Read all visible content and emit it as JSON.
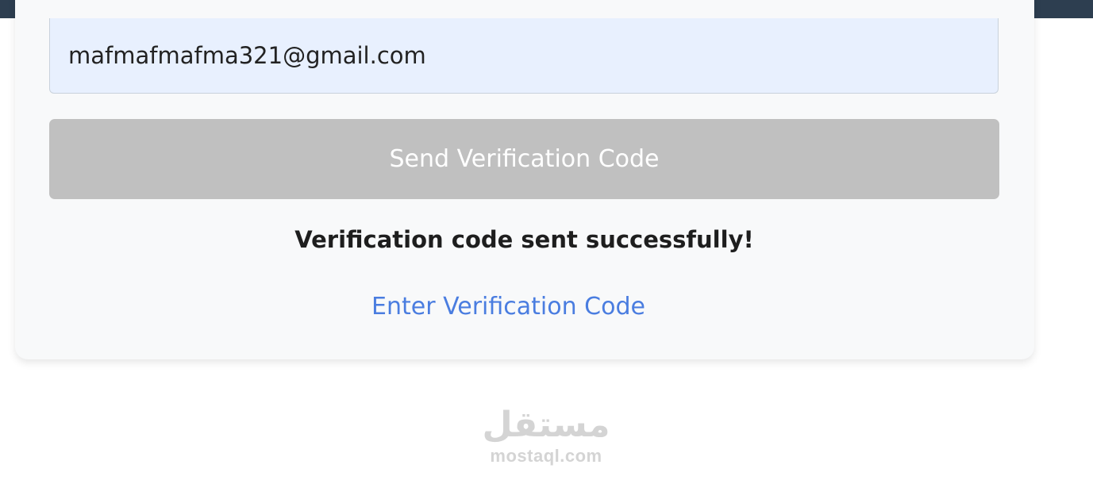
{
  "form": {
    "email_value": "mafmafmafma321@gmail.com",
    "send_button_label": "Send Verification Code",
    "status_message": "Verification code sent successfully!",
    "verify_link_label": "Enter Verification Code"
  },
  "watermark": {
    "arabic": "مستقل",
    "latin": "mostaql.com"
  },
  "colors": {
    "top_bar": "#2d3e50",
    "card_background": "#f8f9fa",
    "input_background": "#e8f0fe",
    "button_disabled": "#c0c0c0",
    "link": "#4a7de0",
    "status_text": "#1e1e1e",
    "watermark": "#d4d4d4"
  }
}
